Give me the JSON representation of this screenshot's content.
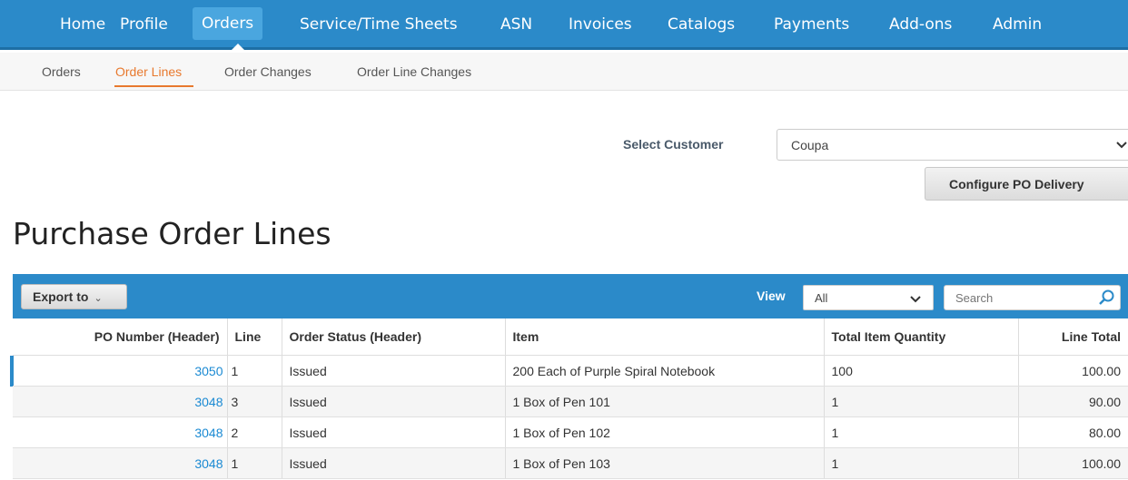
{
  "topnav": {
    "items": [
      "Home",
      "Profile",
      "Orders",
      "Service/Time Sheets",
      "ASN",
      "Invoices",
      "Catalogs",
      "Payments",
      "Add-ons",
      "Admin"
    ],
    "active": "Orders"
  },
  "subnav": {
    "items": [
      "Orders",
      "Order Lines",
      "Order Changes",
      "Order Line Changes"
    ],
    "active": "Order Lines"
  },
  "customer": {
    "label": "Select Customer",
    "value": "Coupa",
    "configure_label": "Configure PO Delivery"
  },
  "page_title": "Purchase Order Lines",
  "toolbar": {
    "export_label": "Export to",
    "view_label": "View",
    "view_value": "All",
    "search_placeholder": "Search"
  },
  "table": {
    "headers": [
      "PO Number (Header)",
      "Line",
      "Order Status (Header)",
      "Item",
      "Total Item Quantity",
      "Line Total"
    ],
    "rows": [
      {
        "po": "3050",
        "line": "1",
        "status": "Issued",
        "item": "200 Each of Purple Spiral Notebook",
        "qty": "100",
        "total": "100.00"
      },
      {
        "po": "3048",
        "line": "3",
        "status": "Issued",
        "item": "1 Box of Pen 101",
        "qty": "1",
        "total": "90.00"
      },
      {
        "po": "3048",
        "line": "2",
        "status": "Issued",
        "item": "1 Box of Pen 102",
        "qty": "1",
        "total": "80.00"
      },
      {
        "po": "3048",
        "line": "1",
        "status": "Issued",
        "item": "1 Box of Pen 103",
        "qty": "1",
        "total": "100.00"
      }
    ]
  },
  "colors": {
    "primary_blue": "#2b8ac9",
    "active_tab_orange": "#e8792e",
    "link_blue": "#1b8ad3"
  }
}
